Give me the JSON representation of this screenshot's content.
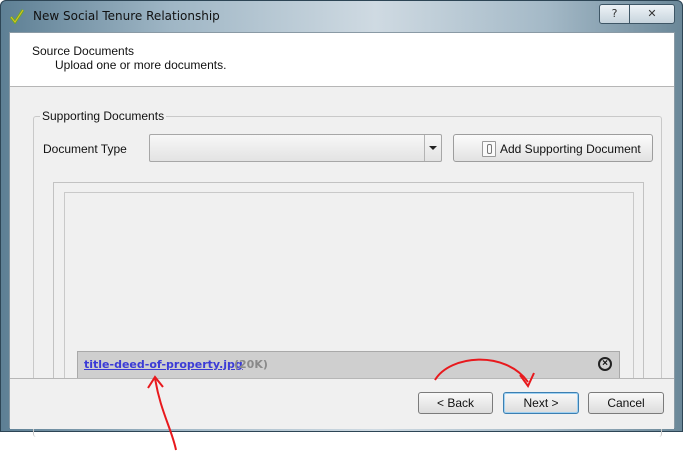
{
  "window": {
    "title": "New Social Tenure Relationship",
    "help_label": "?",
    "close_label": "✕"
  },
  "header": {
    "title": "Source Documents",
    "subtitle": "Upload one or more documents."
  },
  "supporting": {
    "group_title": "Supporting Documents",
    "document_type_label": "Document Type",
    "document_type_value": "",
    "add_button_label": "Add Supporting Document"
  },
  "documents": [
    {
      "file_name": "title-deed-of-property.jpg",
      "size": "(20K)"
    }
  ],
  "buttons": {
    "back": "< Back",
    "next": "Next >",
    "cancel": "Cancel"
  },
  "annotation": {
    "color": "#e8191d"
  }
}
